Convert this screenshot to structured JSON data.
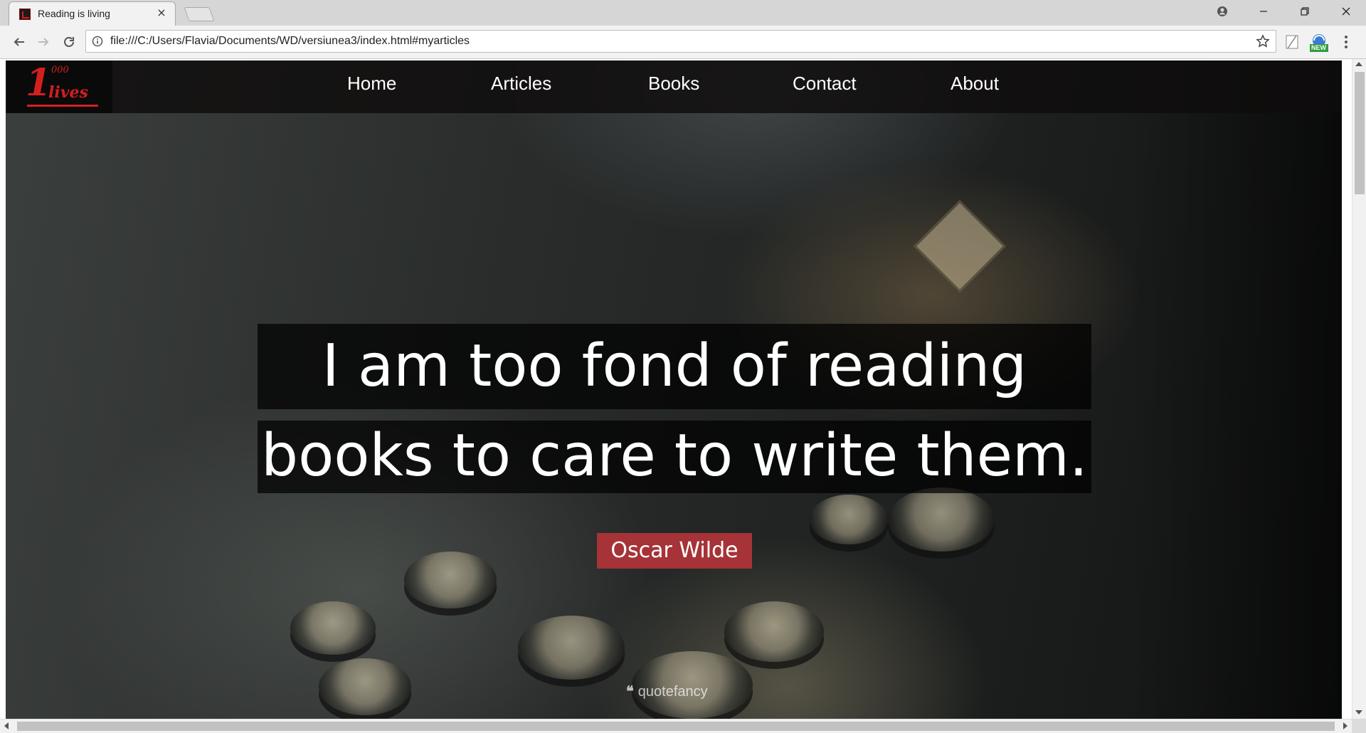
{
  "browser": {
    "tab_title": "Reading is living",
    "tab_close": "×",
    "url": "file:///C:/Users/Flavia/Documents/WD/versiunea3/index.html#myarticles",
    "extension_badge": "NEW"
  },
  "site": {
    "logo": {
      "digit": "1",
      "sup": "000",
      "word": "lives"
    },
    "nav": [
      "Home",
      "Articles",
      "Books",
      "Contact",
      "About"
    ]
  },
  "hero": {
    "quote_lines": [
      "I am too fond of reading",
      "books to care to write them."
    ],
    "author": "Oscar Wilde",
    "watermark_mark": "❝",
    "watermark": "quotefancy"
  },
  "colors": {
    "accent": "#a63337",
    "logo_red": "#d41f1f",
    "nav_bg": "#0f0c0c"
  }
}
